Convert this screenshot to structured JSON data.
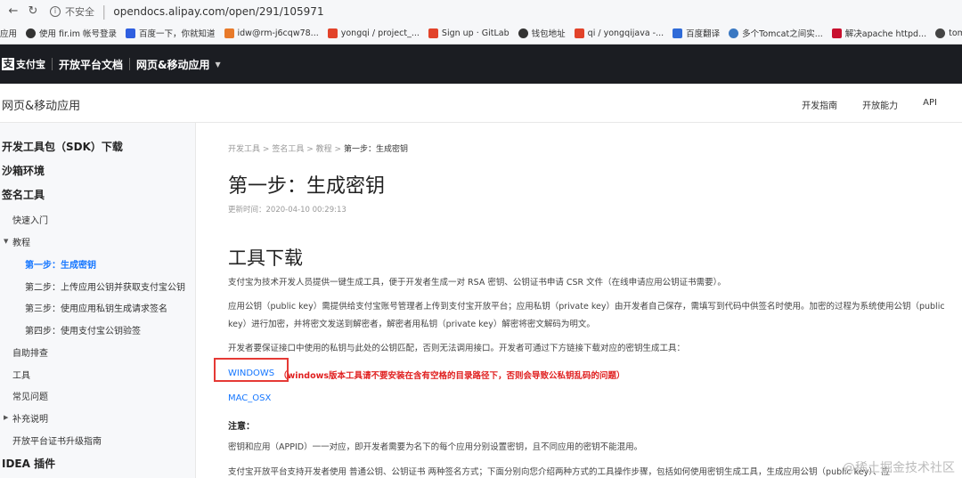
{
  "browser": {
    "security_label": "不安全",
    "url": "opendocs.alipay.com/open/291/105971",
    "bookmarks": [
      {
        "label": "应用",
        "color": "#4a7bd8"
      },
      {
        "label": "使用 fir.im 帐号登录",
        "color": "#333333"
      },
      {
        "label": "百度一下，你就知道",
        "color": "#2f5fe0"
      },
      {
        "label": "idw@rm-j6cqw78...",
        "color": "#e87a2a"
      },
      {
        "label": "yongqi / project_...",
        "color": "#e2432a"
      },
      {
        "label": "Sign up · GitLab",
        "color": "#e2432a"
      },
      {
        "label": "钱包地址",
        "color": "#333333"
      },
      {
        "label": "qi / yongqijava -...",
        "color": "#e2432a"
      },
      {
        "label": "百度翻译",
        "color": "#2f6bd8"
      },
      {
        "label": "多个Tomcat之间实...",
        "color": "#3a78c2"
      },
      {
        "label": "解决apache httpd...",
        "color": "#c8102e"
      },
      {
        "label": "tomcat",
        "color": "#444444"
      }
    ]
  },
  "topbar": {
    "logo_mark": "支",
    "logo_text": "支付宝",
    "title": "开放平台文档",
    "subtitle": "网页&移动应用"
  },
  "subheader": {
    "title": "网页&移动应用",
    "nav": [
      "开发指南",
      "开放能力",
      "API"
    ]
  },
  "sidebar": {
    "items": [
      {
        "label": "开发工具包（SDK）下载"
      },
      {
        "label": "沙箱环境"
      },
      {
        "label": "签名工具"
      },
      {
        "label": "快速入门"
      },
      {
        "label": "教程"
      },
      {
        "label": "第一步：生成密钥"
      },
      {
        "label": "第二步：上传应用公钥并获取支付宝公钥"
      },
      {
        "label": "第三步：使用应用私钥生成请求签名"
      },
      {
        "label": "第四步：使用支付宝公钥验签"
      },
      {
        "label": "自助排查"
      },
      {
        "label": "工具"
      },
      {
        "label": "常见问题"
      },
      {
        "label": "补充说明"
      },
      {
        "label": "开放平台证书升级指南"
      },
      {
        "label": "IDEA 插件"
      }
    ]
  },
  "content": {
    "breadcrumb": [
      "开发工具",
      "签名工具",
      "教程",
      "第一步：生成密钥"
    ],
    "breadcrumb_sep": ">",
    "page_title": "第一步：生成密钥",
    "updated": "更新时间：2020-04-10 00:29:13",
    "section_title": "工具下载",
    "para1": "支付宝为技术开发人员提供一键生成工具，便于开发者生成一对 RSA 密钥、公钥证书申请 CSR 文件（在线申请应用公钥证书需要）。",
    "para2": "应用公钥（public key）需提供给支付宝账号管理者上传到支付宝开放平台；应用私钥（private key）由开发者自己保存，需填写到代码中供签名时使用。加密的过程为系统使用公钥（public key）进行加密，并将密文发送到解密者，解密者用私钥（private key）解密将密文解码为明文。",
    "para3": "开发者要保证接口中使用的私钥与此处的公钥匹配，否则无法调用接口。开发者可通过下方链接下载对应的密钥生成工具：",
    "link_windows": "WINDOWS",
    "windows_warning": "（windows版本工具请不要安装在含有空格的目录路径下，否则会导致公私钥乱码的问题）",
    "link_mac": "MAC_OSX",
    "note_label": "注意：",
    "para4": "密钥和应用（APPID）一一对应，即开发者需要为名下的每个应用分别设置密钥，且不同应用的密钥不能混用。",
    "para5": "支付宝开放平台支持开发者使用 普通公钥、公钥证书 两种签名方式；下面分别向您介绍两种方式的工具操作步骤，包括如何使用密钥生成工具，生成应用公钥（public key）、应"
  },
  "watermark": "@稀土掘金技术社区"
}
